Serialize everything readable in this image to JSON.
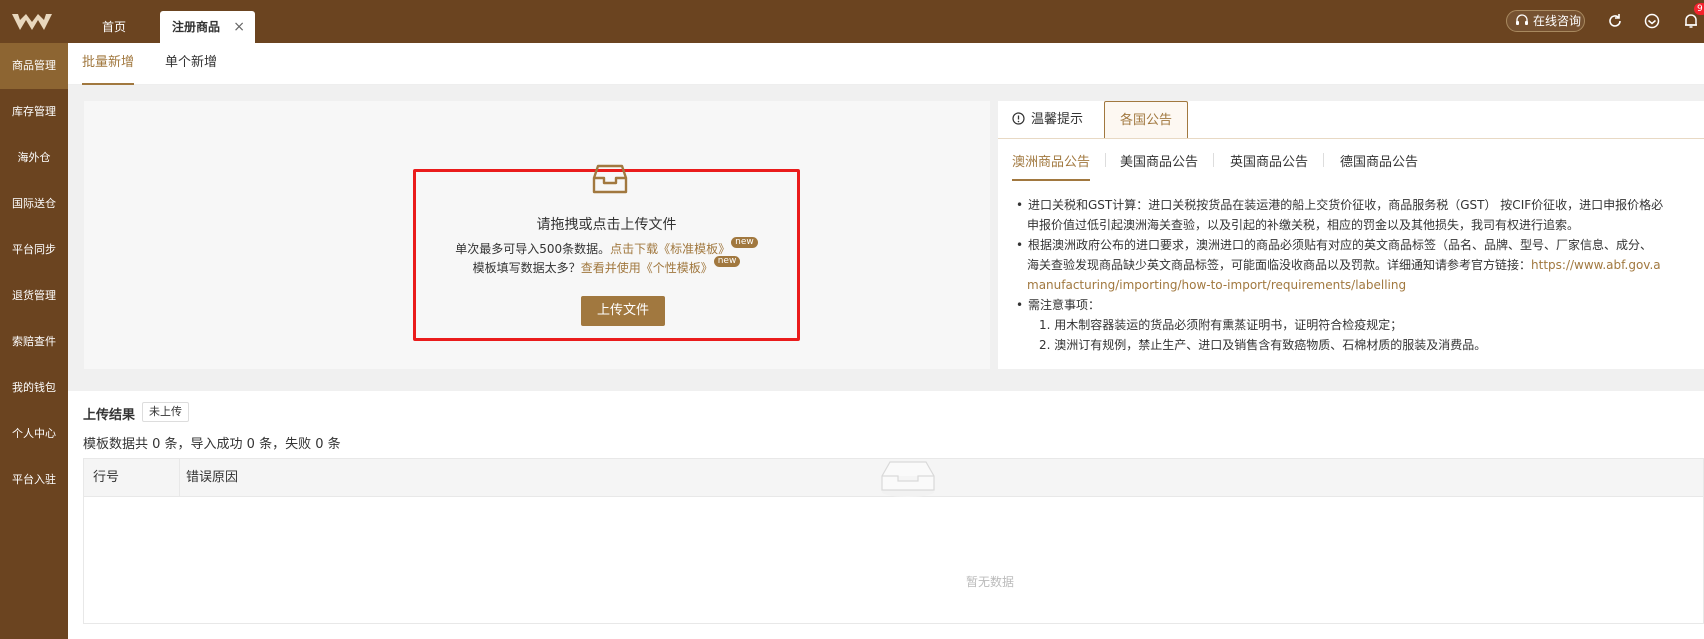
{
  "topbar": {
    "tabs": [
      {
        "label": "首页"
      },
      {
        "label": "注册商品",
        "close": "×"
      }
    ],
    "consult_label": "在线咨询",
    "badge": "9"
  },
  "sidebar": {
    "items": [
      {
        "label": "商品管理"
      },
      {
        "label": "库存管理"
      },
      {
        "label": "海外仓"
      },
      {
        "label": "国际送仓"
      },
      {
        "label": "平台同步"
      },
      {
        "label": "退货管理"
      },
      {
        "label": "索赔查件"
      },
      {
        "label": "我的钱包"
      },
      {
        "label": "个人中心"
      },
      {
        "label": "平台入驻"
      }
    ]
  },
  "main_tabs": [
    {
      "label": "批量新增"
    },
    {
      "label": "单个新增"
    }
  ],
  "upload": {
    "title": "请拖拽或点击上传文件",
    "line1_prefix": "单次最多可导入500条数据。",
    "line1_link": "点击下载《标准模板》",
    "line2_prefix": "模板填写数据太多？",
    "line2_link": "查看并使用《个性模板》",
    "new_tag": "new",
    "button": "上传文件"
  },
  "notice": {
    "tab_tip": "温馨提示",
    "tab_ann": "各国公告",
    "country_tabs": [
      {
        "label": "澳洲商品公告"
      },
      {
        "label": "美国商品公告"
      },
      {
        "label": "英国商品公告"
      },
      {
        "label": "德国商品公告"
      }
    ],
    "lines": [
      "进口关税和GST计算：进口关税按货品在装运港的船上交货价征收，商品服务税（GST） 按CIF价征收，进口申报价格必",
      "申报价值过低引起澳洲海关查验，以及引起的补缴关税，相应的罚金以及其他损失，我司有权进行追索。",
      "根据澳洲政府公布的进口要求，澳洲进口的商品必须贴有对应的英文商品标签（品名、品牌、型号、厂家信息、成分、",
      "海关查验发现商品缺少英文商品标签，可能面临没收商品以及罚款。详细通知请参考官方链接：",
      "https://www.abf.gov.a",
      "manufacturing/importing/how-to-import/requirements/labelling",
      "需注意事项：",
      "1. 用木制容器装运的货品必须附有熏蒸证明书，证明符合检疫规定；",
      "2. 澳洲订有规例，禁止生产、进口及销售含有致癌物质、石棉材质的服装及消费品。"
    ]
  },
  "result": {
    "title": "上传结果",
    "tag": "未上传",
    "summary": "模板数据共 0 条，导入成功 0 条，失败 0 条",
    "columns": [
      "行号",
      "错误原因"
    ],
    "empty": "暂无数据"
  }
}
